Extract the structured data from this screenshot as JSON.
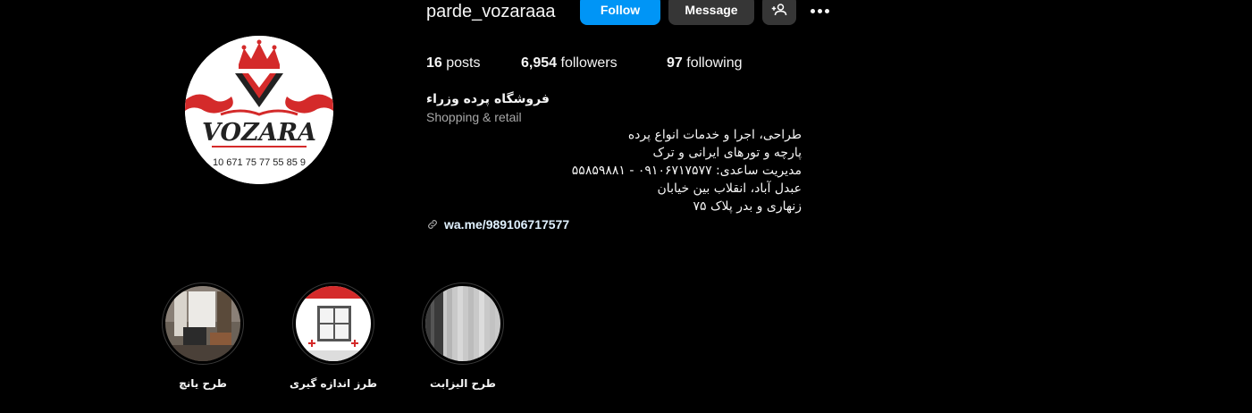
{
  "profile": {
    "username": "parde_vozaraaa",
    "avatar_text": "VOZARA",
    "avatar_phone": "10 671 75 77  55 85 9"
  },
  "actions": {
    "follow_label": "Follow",
    "message_label": "Message",
    "add_user_icon": "add-user-icon",
    "more_icon": "more-icon"
  },
  "stats": {
    "posts_count": "16",
    "posts_label": " posts",
    "followers_count": "6,954",
    "followers_label": " followers",
    "following_count": "97",
    "following_label": " following"
  },
  "bio": {
    "name": "فروشگاه پرده وزراء",
    "category": "Shopping & retail",
    "lines": [
      "طراحی، اجرا و خدمات انواع پرده",
      "پارچه و تورهای ایرانی و ترک",
      "مدیریت ساعدی: ۰۹۱۰۶۷۱۷۵۷۷ - ۵۵۸۵۹۸۸۱",
      "عبدل آباد، انقلاب بین خیابان",
      "زنهاری و بدر پلاک ۷۵"
    ],
    "link": "wa.me/989106717577"
  },
  "highlights": [
    {
      "label": "طرح یانچ"
    },
    {
      "label": "طرز اندازه گیری"
    },
    {
      "label": "طرح الیزابت"
    }
  ],
  "colors": {
    "background": "#000000",
    "follow_button": "#0095f6",
    "secondary_button": "#363636",
    "brand_red": "#d42a2a"
  }
}
